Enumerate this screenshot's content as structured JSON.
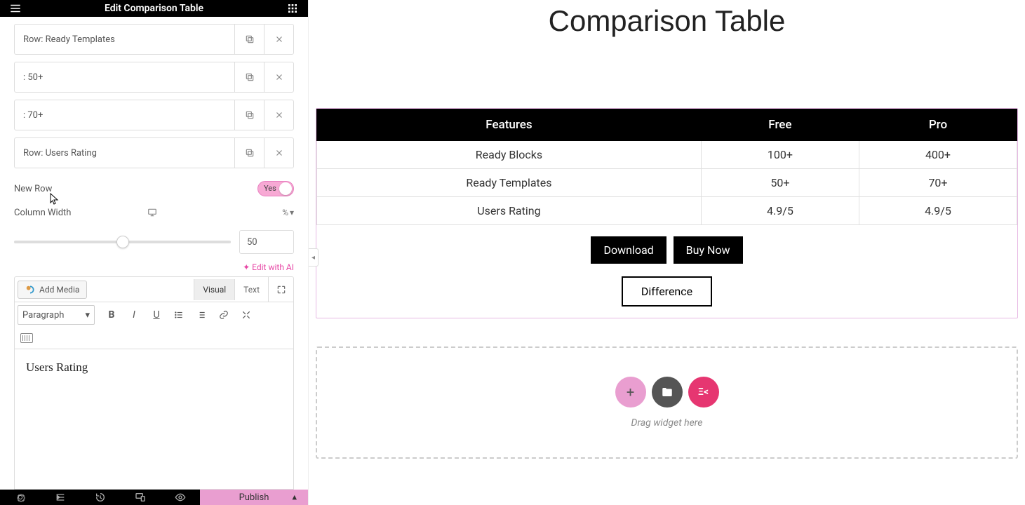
{
  "sidebar": {
    "title": "Edit Comparison Table",
    "rows": [
      {
        "label": "Row: Ready Templates"
      },
      {
        "label": ": 50+"
      },
      {
        "label": ": 70+"
      },
      {
        "label": "Row: Users Rating"
      }
    ],
    "new_row_label": "New Row",
    "new_row_toggle": "Yes",
    "column_width_label": "Column Width",
    "column_width_unit": "%",
    "column_width_value": "50",
    "edit_ai": "Edit with AI",
    "add_media": "Add Media",
    "tab_visual": "Visual",
    "tab_text": "Text",
    "format_select": "Paragraph",
    "editor_content": "Users Rating",
    "publish": "Publish"
  },
  "canvas": {
    "title": "Comparison Table",
    "headers": [
      "Features",
      "Free",
      "Pro"
    ],
    "rows": [
      [
        "Ready Blocks",
        "100+",
        "400+"
      ],
      [
        "Ready Templates",
        "50+",
        "70+"
      ],
      [
        "Users Rating",
        "4.9/5",
        "4.9/5"
      ]
    ],
    "download": "Download",
    "buy_now": "Buy Now",
    "difference": "Difference",
    "drop_text": "Drag widget here"
  }
}
